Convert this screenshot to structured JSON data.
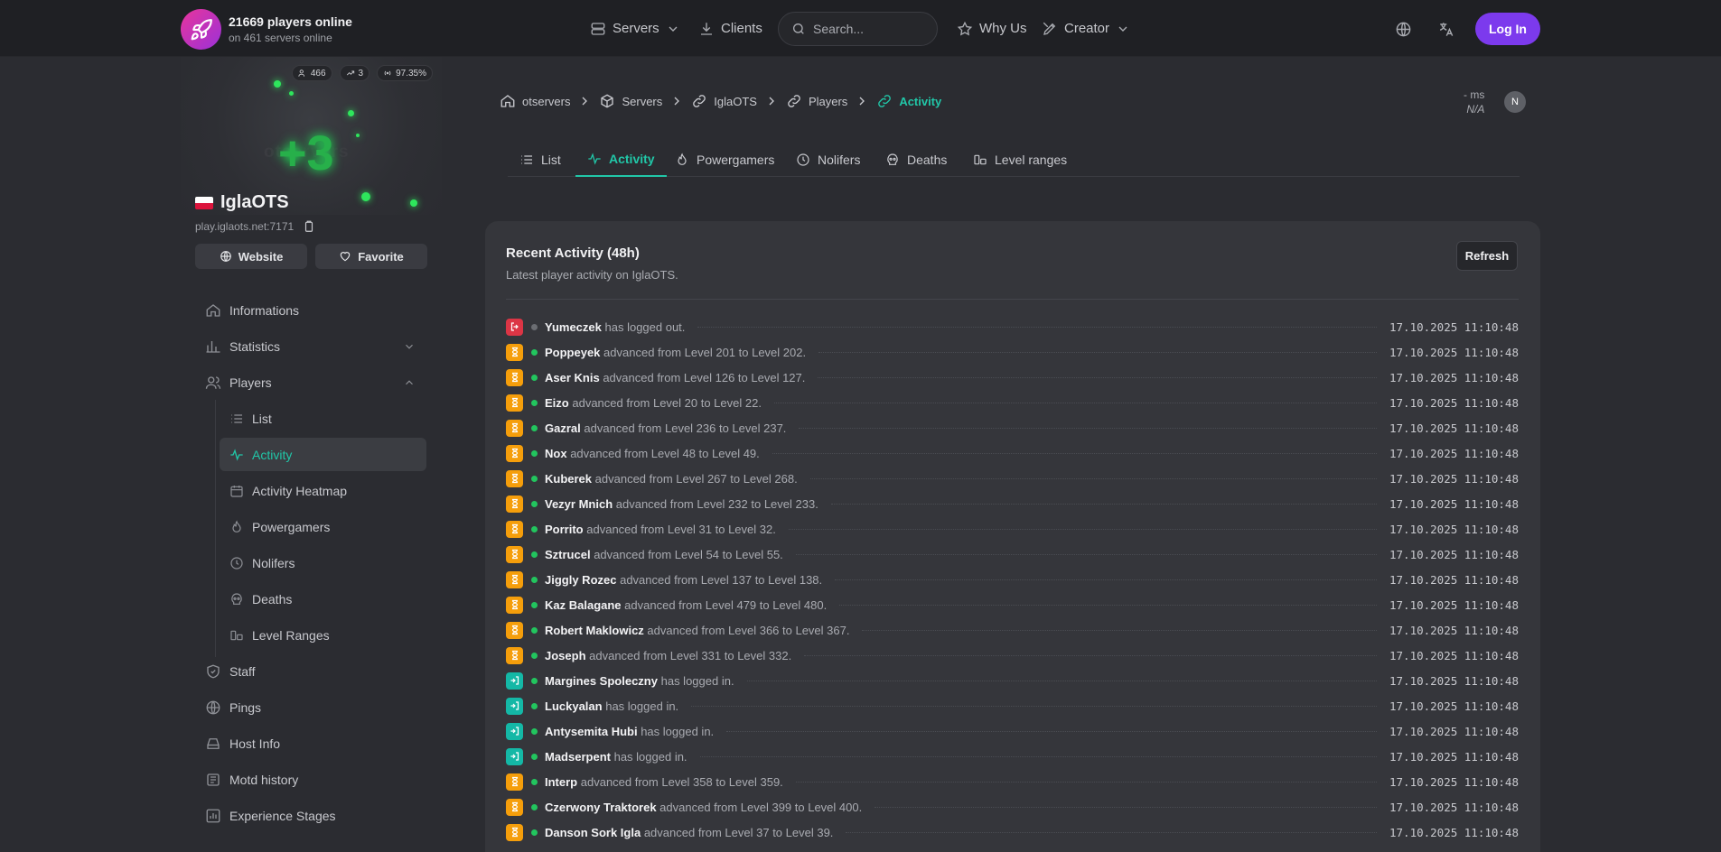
{
  "topbar": {
    "players_online": "21669 players online",
    "servers_online": "on 461 servers online",
    "nav": [
      {
        "label": "Servers",
        "icon": "server-icon"
      },
      {
        "label": "Clients",
        "icon": "download-icon"
      },
      {
        "label": "Why Us",
        "icon": "star-icon"
      },
      {
        "label": "Creator",
        "icon": "pen-tool-icon"
      }
    ],
    "search_placeholder": "Search...",
    "login_label": "Log In",
    "colors": {
      "login": "#7c3aed",
      "accent": "#21c7a8"
    }
  },
  "server": {
    "banner_text": "otservers",
    "banner_plus": "+3",
    "stats": {
      "players": "466",
      "trend": "3",
      "uptime": "97.35%"
    },
    "name": "IglaOTS",
    "address": "play.iglaots.net:7171",
    "website_label": "Website",
    "favorite_label": "Favorite"
  },
  "sidebar": {
    "items": [
      {
        "label": "Informations",
        "icon": "home-icon"
      },
      {
        "label": "Statistics",
        "icon": "bar-chart-icon"
      },
      {
        "label": "Players",
        "icon": "users-icon"
      }
    ],
    "players_sub": [
      {
        "label": "List",
        "icon": "list-icon"
      },
      {
        "label": "Activity",
        "icon": "activity-icon"
      },
      {
        "label": "Activity Heatmap",
        "icon": "calendar-icon"
      },
      {
        "label": "Powergamers",
        "icon": "flame-icon"
      },
      {
        "label": "Nolifers",
        "icon": "clock-icon"
      },
      {
        "label": "Deaths",
        "icon": "skull-icon"
      },
      {
        "label": "Level Ranges",
        "icon": "range-icon"
      }
    ],
    "more": [
      {
        "label": "Staff",
        "icon": "shield-icon"
      },
      {
        "label": "Pings",
        "icon": "globe-icon"
      },
      {
        "label": "Host Info",
        "icon": "hard-drive-icon"
      },
      {
        "label": "Motd history",
        "icon": "newspaper-icon"
      },
      {
        "label": "Experience Stages",
        "icon": "chart-icon"
      }
    ]
  },
  "breadcrumb": [
    "otservers",
    "Servers",
    "IglaOTS",
    "Players",
    "Activity"
  ],
  "ping": {
    "ms": "- ms",
    "na": "N/A"
  },
  "tabs": [
    "List",
    "Activity",
    "Powergamers",
    "Nolifers",
    "Deaths",
    "Level ranges"
  ],
  "activity": {
    "title": "Recent Activity (48h)",
    "subtitle": "Latest player activity on IglaOTS.",
    "refresh_label": "Refresh",
    "rows": [
      {
        "type": "out",
        "online": false,
        "name": "Yumeczek",
        "text": "has logged out.",
        "time": "17.10.2025 11:10:48"
      },
      {
        "type": "lvl",
        "online": true,
        "name": "Poppeyek",
        "text": "advanced from Level 201 to Level 202.",
        "time": "17.10.2025 11:10:48"
      },
      {
        "type": "lvl",
        "online": true,
        "name": "Aser Knis",
        "text": "advanced from Level 126 to Level 127.",
        "time": "17.10.2025 11:10:48"
      },
      {
        "type": "lvl",
        "online": true,
        "name": "Eizo",
        "text": "advanced from Level 20 to Level 22.",
        "time": "17.10.2025 11:10:48"
      },
      {
        "type": "lvl",
        "online": true,
        "name": "Gazral",
        "text": "advanced from Level 236 to Level 237.",
        "time": "17.10.2025 11:10:48"
      },
      {
        "type": "lvl",
        "online": true,
        "name": "Nox",
        "text": "advanced from Level 48 to Level 49.",
        "time": "17.10.2025 11:10:48"
      },
      {
        "type": "lvl",
        "online": true,
        "name": "Kuberek",
        "text": "advanced from Level 267 to Level 268.",
        "time": "17.10.2025 11:10:48"
      },
      {
        "type": "lvl",
        "online": true,
        "name": "Vezyr Mnich",
        "text": "advanced from Level 232 to Level 233.",
        "time": "17.10.2025 11:10:48"
      },
      {
        "type": "lvl",
        "online": true,
        "name": "Porrito",
        "text": "advanced from Level 31 to Level 32.",
        "time": "17.10.2025 11:10:48"
      },
      {
        "type": "lvl",
        "online": true,
        "name": "Sztrucel",
        "text": "advanced from Level 54 to Level 55.",
        "time": "17.10.2025 11:10:48"
      },
      {
        "type": "lvl",
        "online": true,
        "name": "Jiggly Rozec",
        "text": "advanced from Level 137 to Level 138.",
        "time": "17.10.2025 11:10:48"
      },
      {
        "type": "lvl",
        "online": true,
        "name": "Kaz Balagane",
        "text": "advanced from Level 479 to Level 480.",
        "time": "17.10.2025 11:10:48"
      },
      {
        "type": "lvl",
        "online": true,
        "name": "Robert Maklowicz",
        "text": "advanced from Level 366 to Level 367.",
        "time": "17.10.2025 11:10:48"
      },
      {
        "type": "lvl",
        "online": true,
        "name": "Joseph",
        "text": "advanced from Level 331 to Level 332.",
        "time": "17.10.2025 11:10:48"
      },
      {
        "type": "in",
        "online": true,
        "name": "Margines Spoleczny",
        "text": "has logged in.",
        "time": "17.10.2025 11:10:48"
      },
      {
        "type": "in",
        "online": true,
        "name": "Luckyalan",
        "text": "has logged in.",
        "time": "17.10.2025 11:10:48"
      },
      {
        "type": "in",
        "online": true,
        "name": "Antysemita Hubi",
        "text": "has logged in.",
        "time": "17.10.2025 11:10:48"
      },
      {
        "type": "in",
        "online": true,
        "name": "Madserpent",
        "text": "has logged in.",
        "time": "17.10.2025 11:10:48"
      },
      {
        "type": "lvl",
        "online": true,
        "name": "Interp",
        "text": "advanced from Level 358 to Level 359.",
        "time": "17.10.2025 11:10:48"
      },
      {
        "type": "lvl",
        "online": true,
        "name": "Czerwony Traktorek",
        "text": "advanced from Level 399 to Level 400.",
        "time": "17.10.2025 11:10:48"
      },
      {
        "type": "lvl",
        "online": true,
        "name": "Danson Sork Igla",
        "text": "advanced from Level 37 to Level 39.",
        "time": "17.10.2025 11:10:48"
      }
    ]
  }
}
